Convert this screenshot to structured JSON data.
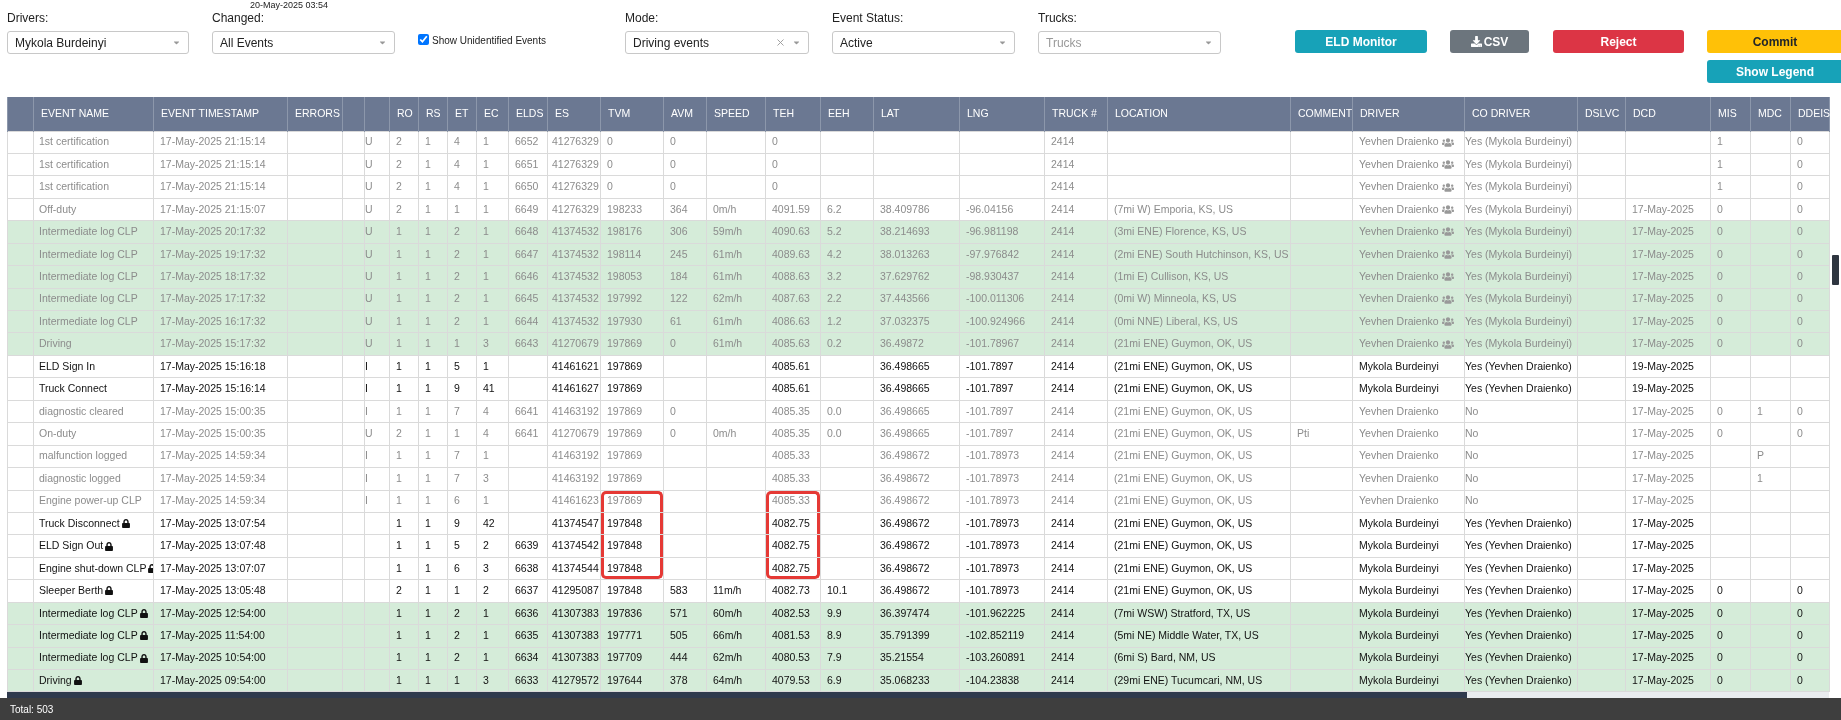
{
  "timestamp": "20-May-2025 03:54",
  "filters": [
    {
      "kind": "select",
      "label": "Drivers:",
      "value": "Mykola Burdeinyi"
    },
    {
      "kind": "select",
      "label": "Changed:",
      "value": "All Events"
    },
    {
      "kind": "checkbox",
      "text": "Show Unidentified Events",
      "checked": true
    },
    {
      "kind": "select",
      "label": "Mode:",
      "value": "Driving events",
      "clearable": true
    },
    {
      "kind": "select",
      "label": "Event Status:",
      "value": "Active"
    },
    {
      "kind": "select",
      "label": "Trucks:",
      "placeholder": "Trucks"
    }
  ],
  "buttons": [
    {
      "label": "ELD Monitor"
    },
    {
      "label": "CSV"
    },
    {
      "label": "Reject"
    }
  ],
  "button_stack": [
    {
      "label": "Commit"
    },
    {
      "label": "Show Legend"
    }
  ],
  "table": {
    "columns": [
      {},
      {
        "label": "EVENT NAME"
      },
      {
        "label": "EVENT TIMESTAMP"
      },
      {
        "label": "ERRORS"
      },
      {},
      {},
      {
        "label": "RO"
      },
      {
        "label": "RS"
      },
      {
        "label": "ET"
      },
      {
        "label": "EC"
      },
      {
        "label": "ELDS"
      },
      {
        "label": "ES"
      },
      {
        "label": "TVM"
      },
      {
        "label": "AVM"
      },
      {
        "label": "SPEED"
      },
      {
        "label": "TEH"
      },
      {
        "label": "EEH"
      },
      {
        "label": "LAT"
      },
      {
        "label": "LNG"
      },
      {
        "label": "TRUCK #"
      },
      {
        "label": "LOCATION"
      },
      {
        "label": "COMMENT"
      },
      {
        "label": "DRIVER"
      },
      {
        "label": "CO DRIVER"
      },
      {
        "label": "DSLVC"
      },
      {
        "label": "DCD"
      },
      {
        "label": "MIS"
      },
      {
        "label": "MDC"
      },
      {
        "label": "DDEIS"
      }
    ],
    "rows": [
      {
        "cells": [
          null,
          "1st certification",
          "17-May-2025 21:15:14",
          null,
          null,
          "U",
          "2",
          "1",
          "4",
          "1",
          "6652",
          "41276329",
          "0",
          "0",
          null,
          "0",
          null,
          null,
          null,
          "2414",
          null,
          null,
          "Yevhen Draienko",
          "Yes (Mykola Burdeinyi)",
          null,
          null,
          "1",
          null,
          "0"
        ],
        "inactive": true,
        "highlighted": false,
        "locked": false,
        "team": true,
        "marked": false
      },
      {
        "cells": [
          null,
          "1st certification",
          "17-May-2025 21:15:14",
          null,
          null,
          "U",
          "2",
          "1",
          "4",
          "1",
          "6651",
          "41276329",
          "0",
          "0",
          null,
          "0",
          null,
          null,
          null,
          "2414",
          null,
          null,
          "Yevhen Draienko",
          "Yes (Mykola Burdeinyi)",
          null,
          null,
          "1",
          null,
          "0"
        ],
        "inactive": true,
        "highlighted": false,
        "locked": false,
        "team": true,
        "marked": false
      },
      {
        "cells": [
          null,
          "1st certification",
          "17-May-2025 21:15:14",
          null,
          null,
          "U",
          "2",
          "1",
          "4",
          "1",
          "6650",
          "41276329",
          "0",
          "0",
          null,
          "0",
          null,
          null,
          null,
          "2414",
          null,
          null,
          "Yevhen Draienko",
          "Yes (Mykola Burdeinyi)",
          null,
          null,
          "1",
          null,
          "0"
        ],
        "inactive": true,
        "highlighted": false,
        "locked": false,
        "team": true,
        "marked": false
      },
      {
        "cells": [
          null,
          "Off-duty",
          "17-May-2025 21:15:07",
          null,
          null,
          "U",
          "2",
          "1",
          "1",
          "1",
          "6649",
          "41276329",
          "198233",
          "364",
          "0m/h",
          "4091.59",
          "6.2",
          "38.409786",
          "-96.04156",
          "2414",
          "(7mi W) Emporia, KS, US",
          null,
          "Yevhen Draienko",
          "Yes (Mykola Burdeinyi)",
          null,
          "17-May-2025",
          "0",
          null,
          "0"
        ],
        "inactive": true,
        "highlighted": false,
        "locked": false,
        "team": true,
        "marked": false
      },
      {
        "cells": [
          null,
          "Intermediate log CLP",
          "17-May-2025 20:17:32",
          null,
          null,
          "U",
          "1",
          "1",
          "2",
          "1",
          "6648",
          "41374532",
          "198176",
          "306",
          "59m/h",
          "4090.63",
          "5.2",
          "38.214693",
          "-96.981198",
          "2414",
          "(3mi ENE) Florence, KS, US",
          null,
          "Yevhen Draienko",
          "Yes (Mykola Burdeinyi)",
          null,
          "17-May-2025",
          "0",
          null,
          "0"
        ],
        "inactive": true,
        "highlighted": true,
        "locked": false,
        "team": true,
        "marked": false
      },
      {
        "cells": [
          null,
          "Intermediate log CLP",
          "17-May-2025 19:17:32",
          null,
          null,
          "U",
          "1",
          "1",
          "2",
          "1",
          "6647",
          "41374532",
          "198114",
          "245",
          "61m/h",
          "4089.63",
          "4.2",
          "38.013263",
          "-97.976842",
          "2414",
          "(2mi ENE) South Hutchinson, KS, US",
          null,
          "Yevhen Draienko",
          "Yes (Mykola Burdeinyi)",
          null,
          "17-May-2025",
          "0",
          null,
          "0"
        ],
        "inactive": true,
        "highlighted": true,
        "locked": false,
        "team": true,
        "marked": false
      },
      {
        "cells": [
          null,
          "Intermediate log CLP",
          "17-May-2025 18:17:32",
          null,
          null,
          "U",
          "1",
          "1",
          "2",
          "1",
          "6646",
          "41374532",
          "198053",
          "184",
          "61m/h",
          "4088.63",
          "3.2",
          "37.629762",
          "-98.930437",
          "2414",
          "(1mi E) Cullison, KS, US",
          null,
          "Yevhen Draienko",
          "Yes (Mykola Burdeinyi)",
          null,
          "17-May-2025",
          "0",
          null,
          "0"
        ],
        "inactive": true,
        "highlighted": true,
        "locked": false,
        "team": true,
        "marked": false
      },
      {
        "cells": [
          null,
          "Intermediate log CLP",
          "17-May-2025 17:17:32",
          null,
          null,
          "U",
          "1",
          "1",
          "2",
          "1",
          "6645",
          "41374532",
          "197992",
          "122",
          "62m/h",
          "4087.63",
          "2.2",
          "37.443566",
          "-100.011306",
          "2414",
          "(0mi W) Minneola, KS, US",
          null,
          "Yevhen Draienko",
          "Yes (Mykola Burdeinyi)",
          null,
          "17-May-2025",
          "0",
          null,
          "0"
        ],
        "inactive": true,
        "highlighted": true,
        "locked": false,
        "team": true,
        "marked": false
      },
      {
        "cells": [
          null,
          "Intermediate log CLP",
          "17-May-2025 16:17:32",
          null,
          null,
          "U",
          "1",
          "1",
          "2",
          "1",
          "6644",
          "41374532",
          "197930",
          "61",
          "61m/h",
          "4086.63",
          "1.2",
          "37.032375",
          "-100.924966",
          "2414",
          "(0mi NNE) Liberal, KS, US",
          null,
          "Yevhen Draienko",
          "Yes (Mykola Burdeinyi)",
          null,
          "17-May-2025",
          "0",
          null,
          "0"
        ],
        "inactive": true,
        "highlighted": true,
        "locked": false,
        "team": true,
        "marked": false
      },
      {
        "cells": [
          null,
          "Driving",
          "17-May-2025 15:17:32",
          null,
          null,
          "U",
          "1",
          "1",
          "1",
          "3",
          "6643",
          "41270679",
          "197869",
          "0",
          "61m/h",
          "4085.63",
          "0.2",
          "36.49872",
          "-101.78967",
          "2414",
          "(21mi ENE) Guymon, OK, US",
          null,
          "Yevhen Draienko",
          "Yes (Mykola Burdeinyi)",
          null,
          "17-May-2025",
          "0",
          null,
          "0"
        ],
        "inactive": true,
        "highlighted": true,
        "locked": false,
        "team": true,
        "marked": false
      },
      {
        "cells": [
          null,
          "ELD Sign In",
          "17-May-2025 15:16:18",
          null,
          null,
          "I",
          "1",
          "1",
          "5",
          "1",
          null,
          "41461621",
          "197869",
          null,
          null,
          "4085.61",
          null,
          "36.498665",
          "-101.7897",
          "2414",
          "(21mi ENE) Guymon, OK, US",
          null,
          "Mykola Burdeinyi",
          "Yes (Yevhen Draienko)",
          null,
          "19-May-2025",
          null,
          null,
          null
        ],
        "inactive": false,
        "highlighted": false,
        "locked": false,
        "team": false,
        "marked": false
      },
      {
        "cells": [
          null,
          "Truck Connect",
          "17-May-2025 15:16:14",
          null,
          null,
          "I",
          "1",
          "1",
          "9",
          "41",
          null,
          "41461627",
          "197869",
          null,
          null,
          "4085.61",
          null,
          "36.498665",
          "-101.7897",
          "2414",
          "(21mi ENE) Guymon, OK, US",
          null,
          "Mykola Burdeinyi",
          "Yes (Yevhen Draienko)",
          null,
          "19-May-2025",
          null,
          null,
          null
        ],
        "inactive": false,
        "highlighted": false,
        "locked": false,
        "team": false,
        "marked": false
      },
      {
        "cells": [
          null,
          "diagnostic cleared",
          "17-May-2025 15:00:35",
          null,
          null,
          "I",
          "1",
          "1",
          "7",
          "4",
          "6641",
          "41463192",
          "197869",
          "0",
          null,
          "4085.35",
          "0.0",
          "36.498665",
          "-101.7897",
          "2414",
          "(21mi ENE) Guymon, OK, US",
          null,
          "Yevhen Draienko",
          "No",
          null,
          "17-May-2025",
          "0",
          "1",
          "0"
        ],
        "inactive": true,
        "highlighted": false,
        "locked": false,
        "team": false,
        "marked": false
      },
      {
        "cells": [
          null,
          "On-duty",
          "17-May-2025 15:00:35",
          null,
          null,
          "U",
          "2",
          "1",
          "1",
          "4",
          "6641",
          "41270679",
          "197869",
          "0",
          "0m/h",
          "4085.35",
          "0.0",
          "36.498665",
          "-101.7897",
          "2414",
          "(21mi ENE) Guymon, OK, US",
          "Pti",
          "Yevhen Draienko",
          "No",
          null,
          "17-May-2025",
          "0",
          null,
          "0"
        ],
        "inactive": true,
        "highlighted": false,
        "locked": false,
        "team": false,
        "marked": false
      },
      {
        "cells": [
          null,
          "malfunction logged",
          "17-May-2025 14:59:34",
          null,
          null,
          "I",
          "1",
          "1",
          "7",
          "1",
          null,
          "41463192",
          "197869",
          null,
          null,
          "4085.33",
          null,
          "36.498672",
          "-101.78973",
          "2414",
          "(21mi ENE) Guymon, OK, US",
          null,
          "Yevhen Draienko",
          "No",
          null,
          "17-May-2025",
          null,
          "P",
          null
        ],
        "inactive": true,
        "highlighted": false,
        "locked": false,
        "team": false,
        "marked": false
      },
      {
        "cells": [
          null,
          "diagnostic logged",
          "17-May-2025 14:59:34",
          null,
          null,
          "I",
          "1",
          "1",
          "7",
          "3",
          null,
          "41463192",
          "197869",
          null,
          null,
          "4085.33",
          null,
          "36.498672",
          "-101.78973",
          "2414",
          "(21mi ENE) Guymon, OK, US",
          null,
          "Yevhen Draienko",
          "No",
          null,
          "17-May-2025",
          null,
          "1",
          null
        ],
        "inactive": true,
        "highlighted": false,
        "locked": false,
        "team": false,
        "marked": false
      },
      {
        "cells": [
          null,
          "Engine power-up CLP",
          "17-May-2025 14:59:34",
          null,
          null,
          "I",
          "1",
          "1",
          "6",
          "1",
          null,
          "41461623",
          "197869",
          null,
          null,
          "4085.33",
          null,
          "36.498672",
          "-101.78973",
          "2414",
          "(21mi ENE) Guymon, OK, US",
          null,
          "Yevhen Draienko",
          "No",
          null,
          "17-May-2025",
          null,
          null,
          null
        ],
        "inactive": true,
        "highlighted": false,
        "locked": false,
        "team": false,
        "marked": true
      },
      {
        "cells": [
          null,
          "Truck Disconnect",
          "17-May-2025 13:07:54",
          null,
          null,
          null,
          "1",
          "1",
          "9",
          "42",
          null,
          "41374547",
          "197848",
          null,
          null,
          "4082.75",
          null,
          "36.498672",
          "-101.78973",
          "2414",
          "(21mi ENE) Guymon, OK, US",
          null,
          "Mykola Burdeinyi",
          "Yes (Yevhen Draienko)",
          null,
          "17-May-2025",
          null,
          null,
          null
        ],
        "inactive": false,
        "highlighted": false,
        "locked": true,
        "team": false,
        "marked": true
      },
      {
        "cells": [
          null,
          "ELD Sign Out",
          "17-May-2025 13:07:48",
          null,
          null,
          null,
          "1",
          "1",
          "5",
          "2",
          "6639",
          "41374542",
          "197848",
          null,
          null,
          "4082.75",
          null,
          "36.498672",
          "-101.78973",
          "2414",
          "(21mi ENE) Guymon, OK, US",
          null,
          "Mykola Burdeinyi",
          "Yes (Yevhen Draienko)",
          null,
          "17-May-2025",
          null,
          null,
          null
        ],
        "inactive": false,
        "highlighted": false,
        "locked": true,
        "team": false,
        "marked": true
      },
      {
        "cells": [
          null,
          "Engine shut-down CLP",
          "17-May-2025 13:07:07",
          null,
          null,
          null,
          "1",
          "1",
          "6",
          "3",
          "6638",
          "41374544",
          "197848",
          null,
          null,
          "4082.75",
          null,
          "36.498672",
          "-101.78973",
          "2414",
          "(21mi ENE) Guymon, OK, US",
          null,
          "Mykola Burdeinyi",
          "Yes (Yevhen Draienko)",
          null,
          "17-May-2025",
          null,
          null,
          null
        ],
        "inactive": false,
        "highlighted": false,
        "locked": true,
        "team": false,
        "marked": true
      },
      {
        "cells": [
          null,
          "Sleeper Berth",
          "17-May-2025 13:05:48",
          null,
          null,
          null,
          "2",
          "1",
          "1",
          "2",
          "6637",
          "41295087",
          "197848",
          "583",
          "11m/h",
          "4082.73",
          "10.1",
          "36.498672",
          "-101.78973",
          "2414",
          "(21mi ENE) Guymon, OK, US",
          null,
          "Mykola Burdeinyi",
          "Yes (Yevhen Draienko)",
          null,
          "17-May-2025",
          "0",
          null,
          "0"
        ],
        "inactive": false,
        "highlighted": false,
        "locked": true,
        "team": false,
        "marked": false
      },
      {
        "cells": [
          null,
          "Intermediate log CLP",
          "17-May-2025 12:54:00",
          null,
          null,
          null,
          "1",
          "1",
          "2",
          "1",
          "6636",
          "41307383",
          "197836",
          "571",
          "60m/h",
          "4082.53",
          "9.9",
          "36.397474",
          "-101.962225",
          "2414",
          "(7mi WSW) Stratford, TX, US",
          null,
          "Mykola Burdeinyi",
          "Yes (Yevhen Draienko)",
          null,
          "17-May-2025",
          "0",
          null,
          "0"
        ],
        "inactive": false,
        "highlighted": true,
        "locked": true,
        "team": false,
        "marked": false
      },
      {
        "cells": [
          null,
          "Intermediate log CLP",
          "17-May-2025 11:54:00",
          null,
          null,
          null,
          "1",
          "1",
          "2",
          "1",
          "6635",
          "41307383",
          "197771",
          "505",
          "66m/h",
          "4081.53",
          "8.9",
          "35.791399",
          "-102.852119",
          "2414",
          "(5mi NE) Middle Water, TX, US",
          null,
          "Mykola Burdeinyi",
          "Yes (Yevhen Draienko)",
          null,
          "17-May-2025",
          "0",
          null,
          "0"
        ],
        "inactive": false,
        "highlighted": true,
        "locked": true,
        "team": false,
        "marked": false
      },
      {
        "cells": [
          null,
          "Intermediate log CLP",
          "17-May-2025 10:54:00",
          null,
          null,
          null,
          "1",
          "1",
          "2",
          "1",
          "6634",
          "41307383",
          "197709",
          "444",
          "62m/h",
          "4080.53",
          "7.9",
          "35.21554",
          "-103.260891",
          "2414",
          "(6mi S) Bard, NM, US",
          null,
          "Mykola Burdeinyi",
          "Yes (Yevhen Draienko)",
          null,
          "17-May-2025",
          "0",
          null,
          "0"
        ],
        "inactive": false,
        "highlighted": true,
        "locked": true,
        "team": false,
        "marked": false
      },
      {
        "cells": [
          null,
          "Driving",
          "17-May-2025 09:54:00",
          null,
          null,
          null,
          "1",
          "1",
          "1",
          "3",
          "6633",
          "41279572",
          "197644",
          "378",
          "64m/h",
          "4079.53",
          "6.9",
          "35.068233",
          "-104.23838",
          "2414",
          "(29mi ENE) Tucumcari, NM, US",
          null,
          "Mykola Burdeinyi",
          "Yes (Yevhen Draienko)",
          null,
          "17-May-2025",
          "0",
          null,
          "0"
        ],
        "inactive": false,
        "highlighted": true,
        "locked": true,
        "team": false,
        "marked": false
      }
    ]
  },
  "footer": {
    "total": "Total: 503"
  }
}
